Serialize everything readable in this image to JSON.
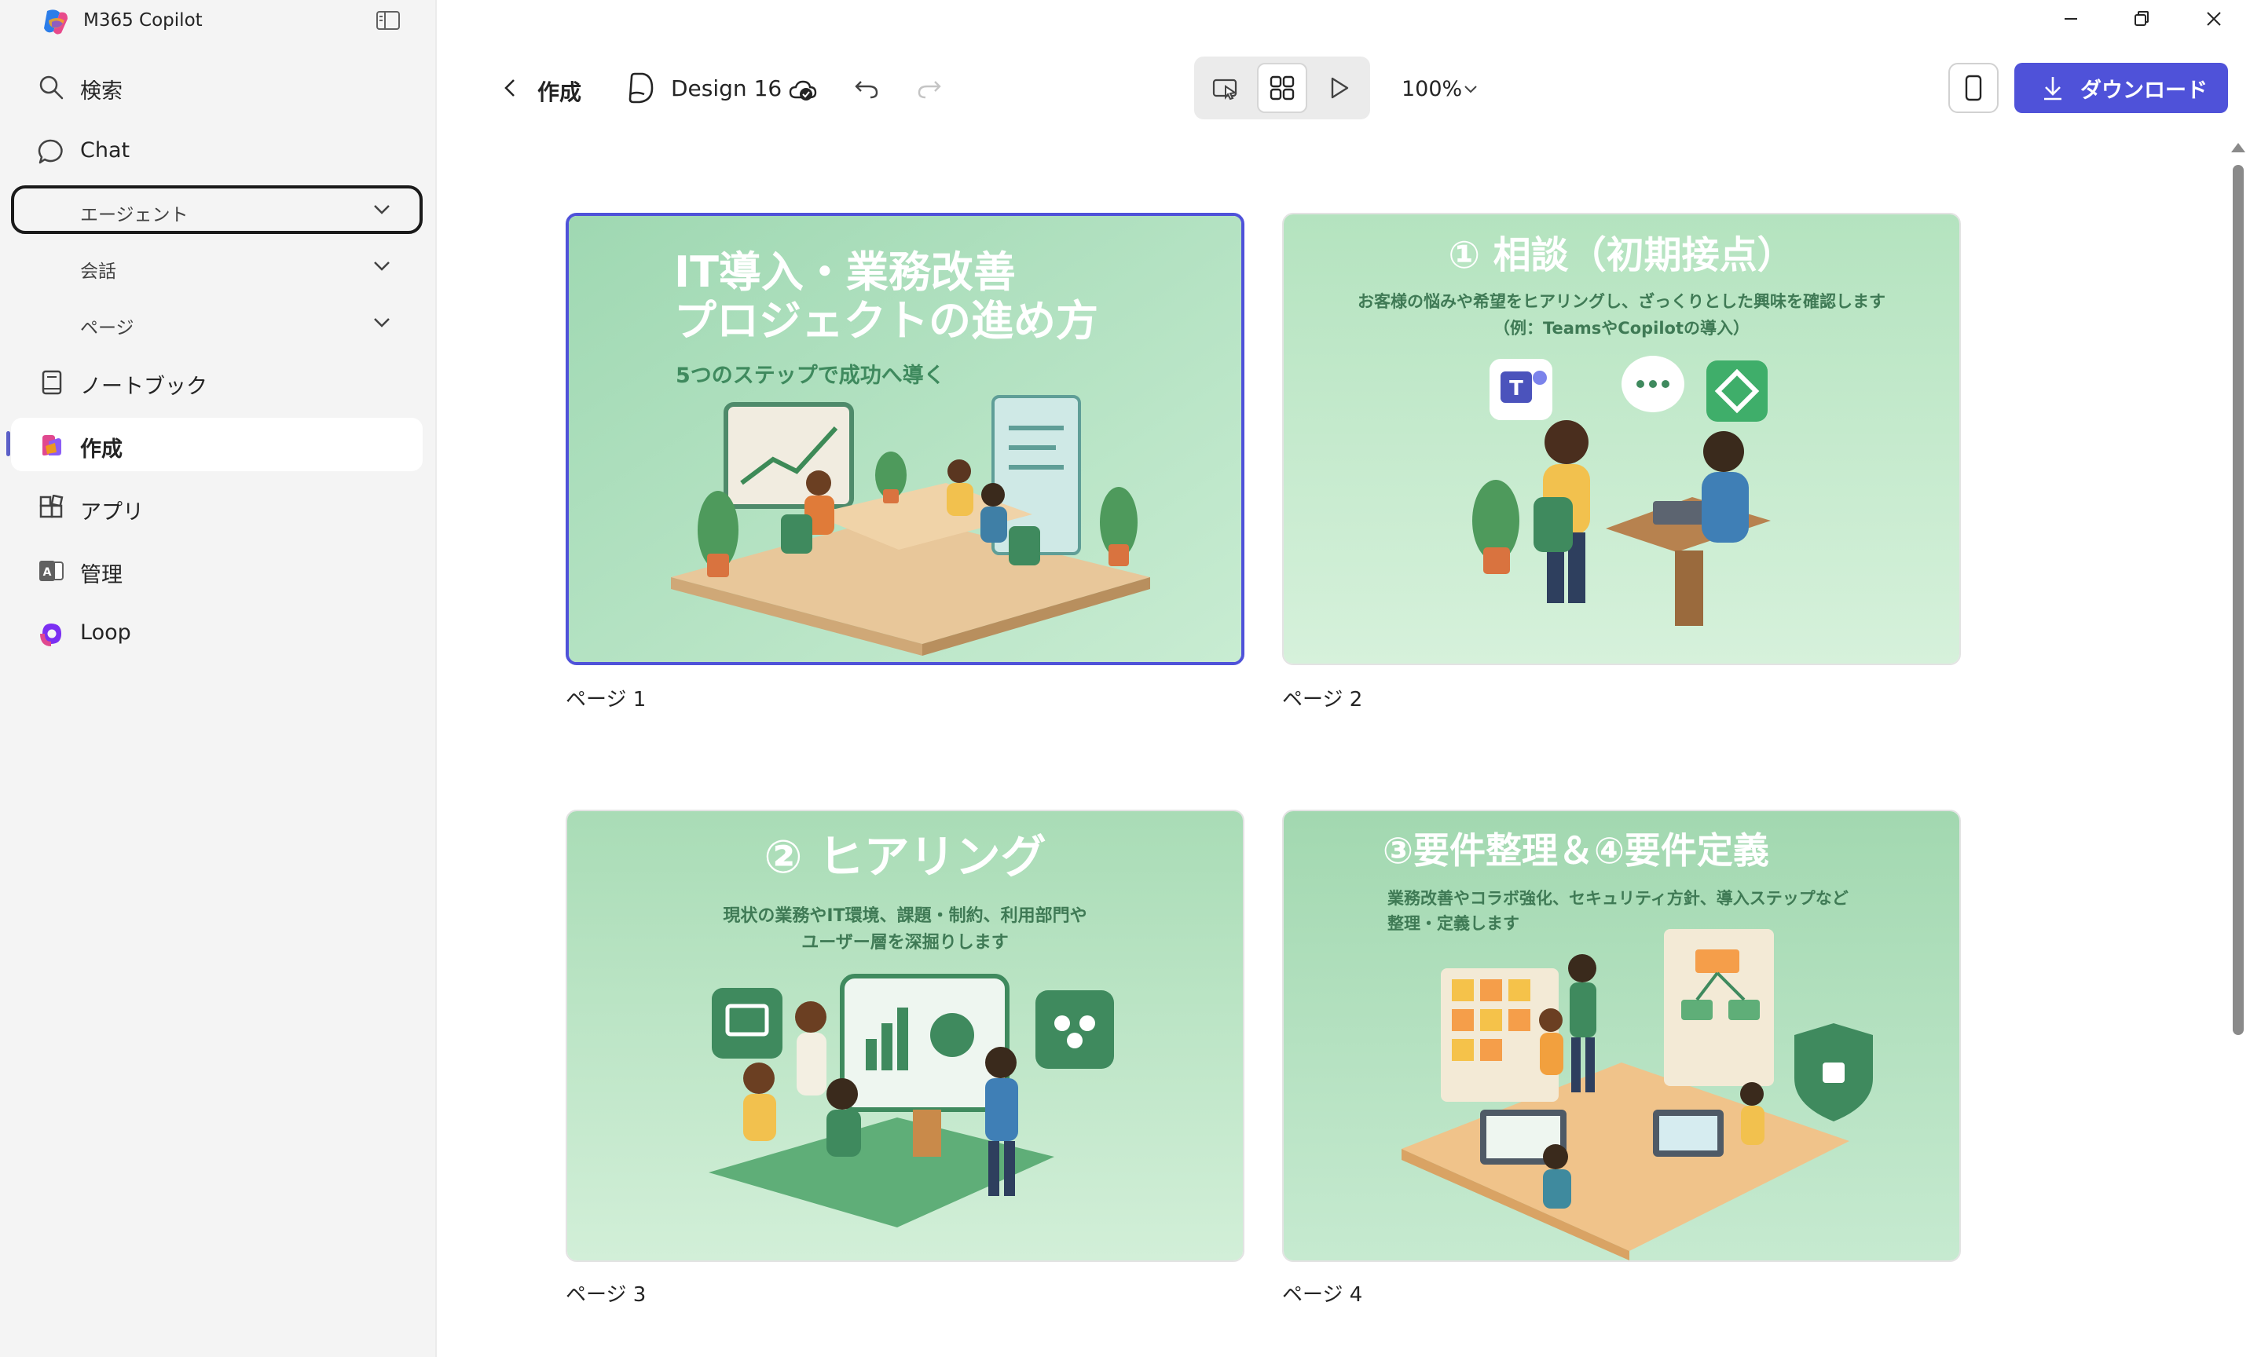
{
  "app": {
    "title": "M365 Copilot"
  },
  "sidebar": {
    "items": [
      {
        "label": "検索",
        "icon": "search-icon"
      },
      {
        "label": "Chat",
        "icon": "chat-icon"
      },
      {
        "label": "ノートブック",
        "icon": "notebook-icon"
      },
      {
        "label": "作成",
        "icon": "create-icon",
        "active": true
      },
      {
        "label": "アプリ",
        "icon": "apps-icon"
      },
      {
        "label": "管理",
        "icon": "admin-icon"
      },
      {
        "label": "Loop",
        "icon": "loop-icon"
      }
    ],
    "sub_items": [
      {
        "label": "エージェント",
        "focused": true
      },
      {
        "label": "会話"
      },
      {
        "label": "ページ"
      }
    ]
  },
  "toolbar": {
    "back_label": "作成",
    "design_title": "Design 16",
    "zoom": "100%",
    "download_label": "ダウンロード"
  },
  "pages": [
    {
      "label": "ページ 1",
      "title_line1": "IT導入・業務改善",
      "title_line2": "プロジェクトの進め方",
      "subtitle": "5つのステップで成功へ導く",
      "selected": true
    },
    {
      "label": "ページ 2",
      "title": "① 相談（初期接点）",
      "body_line1": "お客様の悩みや希望をヒアリングし、ざっくりとした興味を確認します",
      "body_line2": "（例：TeamsやCopilotの導入）"
    },
    {
      "label": "ページ 3",
      "title": "② ヒアリング",
      "body_line1": "現状の業務やIT環境、課題・制約、利用部門や",
      "body_line2": "ユーザー層を深掘りします"
    },
    {
      "label": "ページ 4",
      "title": "③要件整理＆④要件定義",
      "body_line1": "業務改善やコラボ強化、セキュリティ方針、導入ステップなど",
      "body_line2": "整理・定義します"
    }
  ],
  "colors": {
    "accent": "#4f52d9",
    "slide_bg": "#a8dbb5",
    "slide_title": "#ffffff"
  }
}
